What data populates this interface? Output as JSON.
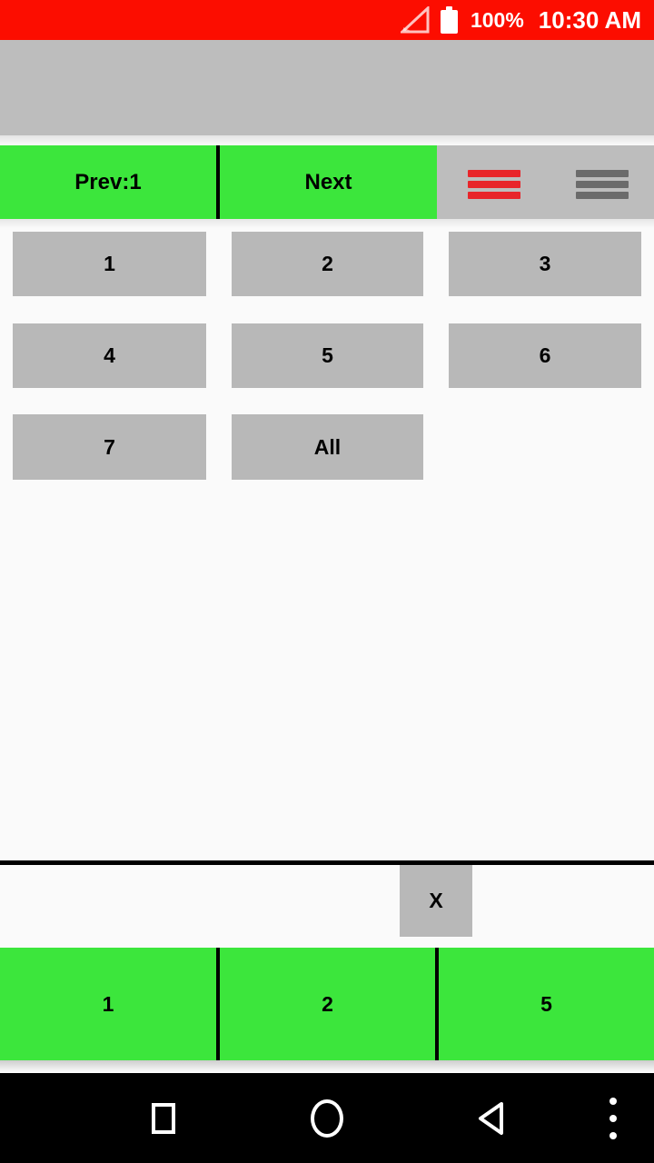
{
  "status_bar": {
    "background_color": "#fc0d00",
    "signal_icon": "signal-triangle-icon",
    "battery_icon": "battery-full-icon",
    "battery_percent": "100%",
    "time": "10:30 AM"
  },
  "title_bar": {
    "title": "",
    "background_color": "#bdbdbd"
  },
  "nav_row": {
    "prev_label": "Prev:1",
    "next_label": "Next",
    "button_color": "#3ce63c",
    "menu_icon_red": "hamburger-menu-icon",
    "menu_icon_gray": "hamburger-menu-icon"
  },
  "grid": {
    "button_color": "#b8b8b8",
    "rows": [
      [
        {
          "label": "1"
        },
        {
          "label": "2"
        },
        {
          "label": "3"
        }
      ],
      [
        {
          "label": "4"
        },
        {
          "label": "5"
        },
        {
          "label": "6"
        }
      ],
      [
        {
          "label": "7"
        },
        {
          "label": "All"
        }
      ]
    ]
  },
  "panel": {
    "close_label": "X"
  },
  "bottom_strip": {
    "background_color": "#3ce63c",
    "cells": [
      {
        "label": "1"
      },
      {
        "label": "2"
      },
      {
        "label": "5"
      }
    ]
  },
  "android_nav": {
    "recent_icon": "square-icon",
    "home_icon": "circle-icon",
    "back_icon": "triangle-left-icon",
    "more_icon": "three-dots-vertical-icon"
  }
}
